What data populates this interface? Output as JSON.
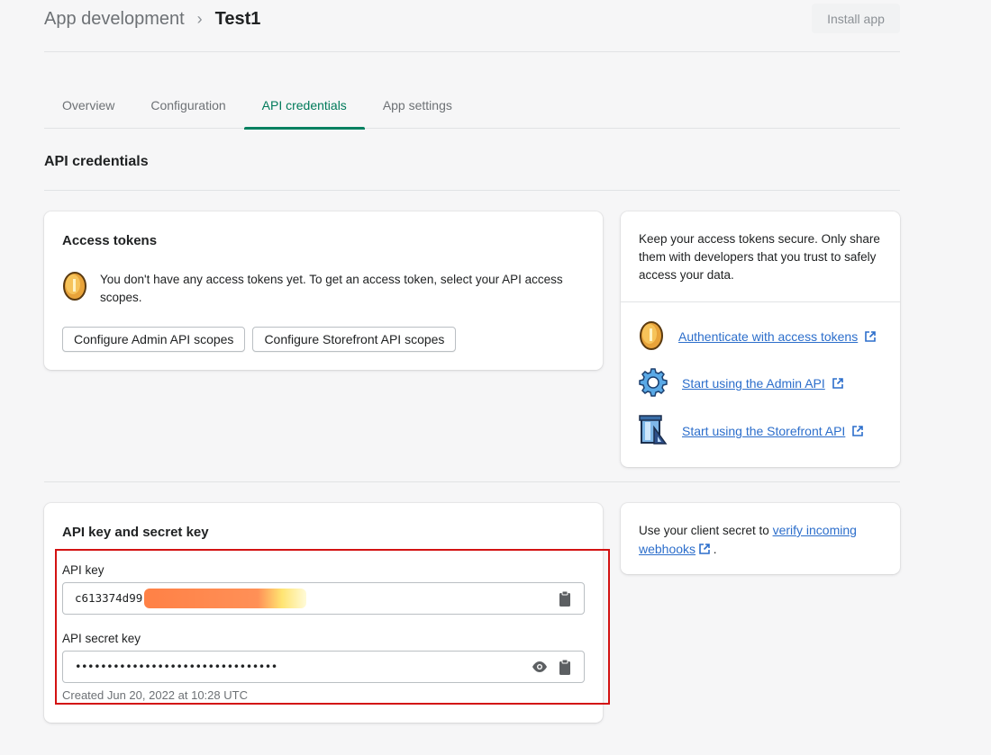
{
  "breadcrumb": {
    "parent": "App development",
    "separator": "›",
    "current": "Test1"
  },
  "header": {
    "install_label": "Install app"
  },
  "tabs": [
    {
      "label": "Overview"
    },
    {
      "label": "Configuration"
    },
    {
      "label": "API credentials",
      "active": true
    },
    {
      "label": "App settings"
    }
  ],
  "section": {
    "title": "API credentials"
  },
  "access_tokens": {
    "title": "Access tokens",
    "empty_text": "You don't have any access tokens yet. To get an access token, select your API access scopes.",
    "icon": "coin-icon",
    "buttons": {
      "admin": "Configure Admin API scopes",
      "storefront": "Configure Storefront API scopes"
    }
  },
  "side_info": {
    "text": "Keep your access tokens secure. Only share them with developers that you trust to safely access your data.",
    "links": [
      {
        "label": "Authenticate with access tokens",
        "icon": "coin-icon"
      },
      {
        "label": "Start using the Admin API",
        "icon": "gear-icon"
      },
      {
        "label": "Start using the Storefront API",
        "icon": "storefront-icon"
      }
    ]
  },
  "keys": {
    "title": "API key and secret key",
    "api_key_label": "API key",
    "api_key_value": "c613374d99",
    "secret_label": "API secret key",
    "secret_value": "••••••••••••••••••••••••••••••••",
    "created": "Created Jun 20, 2022 at 10:28 UTC"
  },
  "webhooks": {
    "prefix": "Use your client secret to ",
    "link": "verify incoming webhooks",
    "suffix": " ."
  },
  "colors": {
    "accent": "#008060",
    "link": "#2c6ecb",
    "highlight": "#d31212"
  }
}
